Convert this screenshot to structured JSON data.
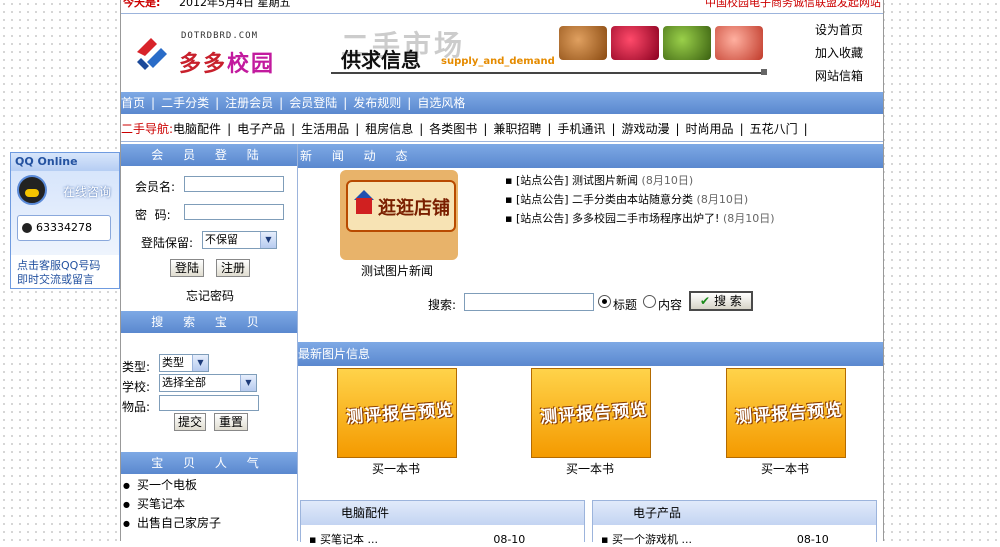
{
  "topbar": {
    "today_label": "今天是:",
    "date": "2012年5月4日 星期五",
    "union": "中国校园电子商务诚信联盟发起网站"
  },
  "logo": {
    "en": "DOTRDBRD.COM",
    "cn_part1": "多多",
    "cn_part2": "校园"
  },
  "banner": {
    "ghost": "二手市场",
    "title": "供求信息",
    "subtitle": "supply_and_demand"
  },
  "toplinks": [
    "设为首页",
    "加入收藏",
    "网站信箱"
  ],
  "mainnav": [
    "首页",
    "二手分类",
    "注册会员",
    "会员登陆",
    "发布规则",
    "自选风格"
  ],
  "catnav": {
    "label": "二手导航:",
    "items": [
      "电脑配件",
      "电子产品",
      "生活用品",
      "租房信息",
      "各类图书",
      "兼职招聘",
      "手机通讯",
      "游戏动漫",
      "时尚用品",
      "五花八门"
    ]
  },
  "login": {
    "title": "会 员 登 陆",
    "username_label": "会员名:",
    "password_label": "密  码:",
    "remember_label": "登陆保留:",
    "remember_value": "不保留",
    "login_btn": "登陆",
    "register_btn": "注册",
    "forgot": "忘记密码"
  },
  "search_items": {
    "title": "搜 索 宝 贝",
    "type_label": "类型:",
    "type_value": "类型",
    "school_label": "学校:",
    "school_value": "选择全部",
    "item_label": "物品:",
    "submit": "提交",
    "reset": "重置"
  },
  "popular": {
    "title": "宝 贝 人 气",
    "items": [
      "买一个电板",
      "买笔记本",
      "出售自己家房子"
    ]
  },
  "news": {
    "title": "新 闻 动 态",
    "shop_caption": "测试图片新闻",
    "shop_text": "逛逛店铺",
    "items": [
      {
        "text": "▪ [站点公告] 测试图片新闻",
        "date": "(8月10日)"
      },
      {
        "text": "▪ [站点公告] 二手分类由本站随意分类",
        "date": "(8月10日)"
      },
      {
        "text": "▪ [站点公告] 多多校园二手市场程序出炉了!",
        "date": "(8月10日)"
      }
    ]
  },
  "searchbar": {
    "label": "搜索:",
    "opt_title": "标题",
    "opt_content": "内容",
    "button": "搜 索"
  },
  "latest": {
    "title": "最新图片信息",
    "thumb_text": "测评报告预览",
    "items": [
      "买一本书",
      "买一本书",
      "买一本书"
    ]
  },
  "catboxes": [
    {
      "title": "电脑配件",
      "row": "▪ 买笔记本 ...                                 08-10"
    },
    {
      "title": "电子产品",
      "row": "▪ 买一个游戏机 ...                              08-10"
    }
  ],
  "qq": {
    "title": "QQ Online",
    "chat": "在线咨询",
    "number": "63334278",
    "foot1": "点击客服QQ号码",
    "foot2": "即时交流或留言"
  },
  "colors": {
    "nav_blue": "#5a88cf",
    "accent_red": "#c8202c"
  }
}
